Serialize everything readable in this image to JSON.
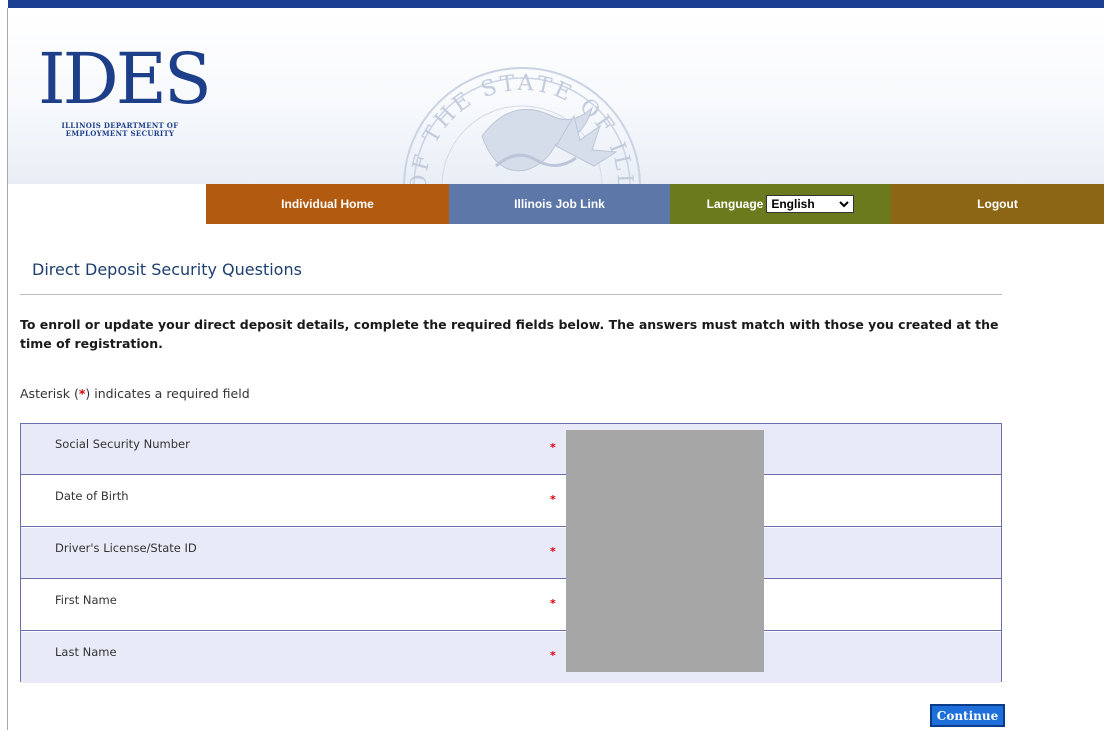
{
  "header": {
    "logo_text": "IDES",
    "logo_subtitle": "ILLINOIS DEPARTMENT OF EMPLOYMENT SECURITY",
    "seal_text": "SEAL OF THE STATE OF ILLINOIS"
  },
  "nav": {
    "home_label": "Individual Home",
    "job_link_label": "Illinois Job Link",
    "language_label": "Language",
    "language_selected": "English",
    "logout_label": "Logout"
  },
  "page": {
    "title": "Direct Deposit Security Questions",
    "intro": "To enroll or update your direct deposit details, complete the required fields below. The answers must match with those you created at the time of registration.",
    "required_prefix": "Asterisk (",
    "required_star": "*",
    "required_suffix": ") indicates a required field"
  },
  "form": {
    "fields": [
      {
        "label": "Social Security Number",
        "marker": "*"
      },
      {
        "label": "Date of Birth",
        "marker": "*"
      },
      {
        "label": "Driver's License/State ID",
        "marker": "*"
      },
      {
        "label": "First Name",
        "marker": "*"
      },
      {
        "label": "Last Name",
        "marker": "*"
      }
    ],
    "continue_label": "Continue"
  },
  "colors": {
    "top_bar": "#1c3f91",
    "nav_home": "#b25a10",
    "nav_job": "#5d78a8",
    "nav_language": "#6a7a1d",
    "nav_logout": "#8c6614",
    "required": "#d8000c",
    "button": "#1e6fd9"
  }
}
